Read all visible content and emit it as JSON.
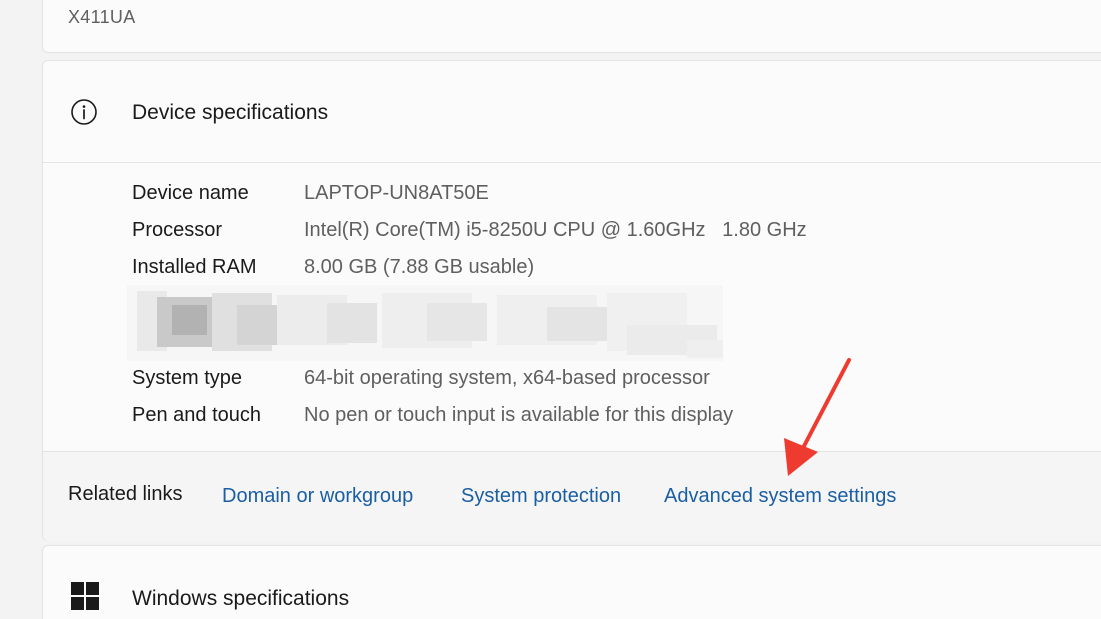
{
  "device": {
    "model": "X411UA"
  },
  "device_specifications": {
    "title": "Device specifications",
    "icon": "info-icon",
    "rows": [
      {
        "label": "Device name",
        "value": "LAPTOP-UN8AT50E"
      },
      {
        "label": "Processor",
        "value": "Intel(R) Core(TM) i5-8250U CPU @ 1.60GHz   1.80 GHz"
      },
      {
        "label": "Installed RAM",
        "value": "8.00 GB (7.88 GB usable)"
      },
      {
        "label": "System type",
        "value": "64-bit operating system, x64-based processor"
      },
      {
        "label": "Pen and touch",
        "value": "No pen or touch input is available for this display"
      }
    ]
  },
  "related_links": {
    "label": "Related links",
    "links": [
      {
        "label": "Domain or workgroup"
      },
      {
        "label": "System protection"
      },
      {
        "label": "Advanced system settings"
      }
    ]
  },
  "windows_specifications": {
    "title": "Windows specifications",
    "icon": "windows-logo-icon"
  },
  "colors": {
    "link": "#1a5ea4",
    "annotation_arrow": "#ee3a2f",
    "secondary_text": "#5f5f5f"
  }
}
